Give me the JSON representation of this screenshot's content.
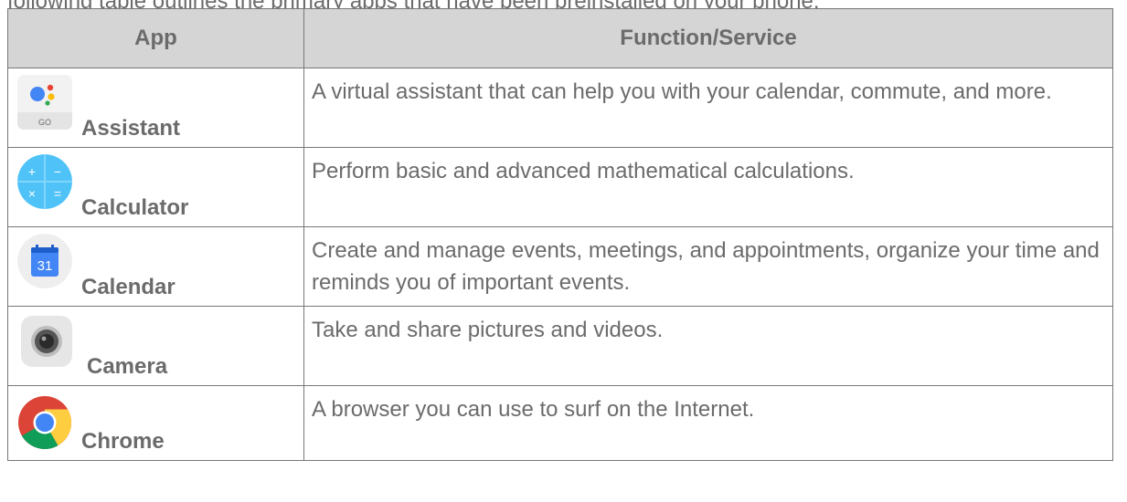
{
  "intro_text": "following table outlines the primary apps that have been preinstalled on your phone.",
  "table": {
    "headers": {
      "app": "App",
      "function": "Function/Service"
    },
    "rows": [
      {
        "app": "Assistant",
        "icon": "assistant-icon",
        "function": "A virtual assistant that can help you with your calendar, commute, and more."
      },
      {
        "app": "Calculator",
        "icon": "calculator-icon",
        "function": "Perform basic and advanced mathematical calculations."
      },
      {
        "app": "Calendar",
        "icon": "calendar-icon",
        "icon_text": "31",
        "function": "Create and manage events, meetings, and appointments, organize your time and reminds you of important events."
      },
      {
        "app": "Camera",
        "icon": "camera-icon",
        "function": "Take and share pictures and videos."
      },
      {
        "app": "Chrome",
        "icon": "chrome-icon",
        "function": "A browser you can use to surf on the Internet."
      }
    ]
  },
  "icons": {
    "assistant_go_label": "GO",
    "calculator_symbols": [
      "+",
      "−",
      "×",
      "="
    ]
  },
  "colors": {
    "text": "#6b6b6b",
    "header_bg": "#d5d5d5",
    "border": "#777777"
  }
}
